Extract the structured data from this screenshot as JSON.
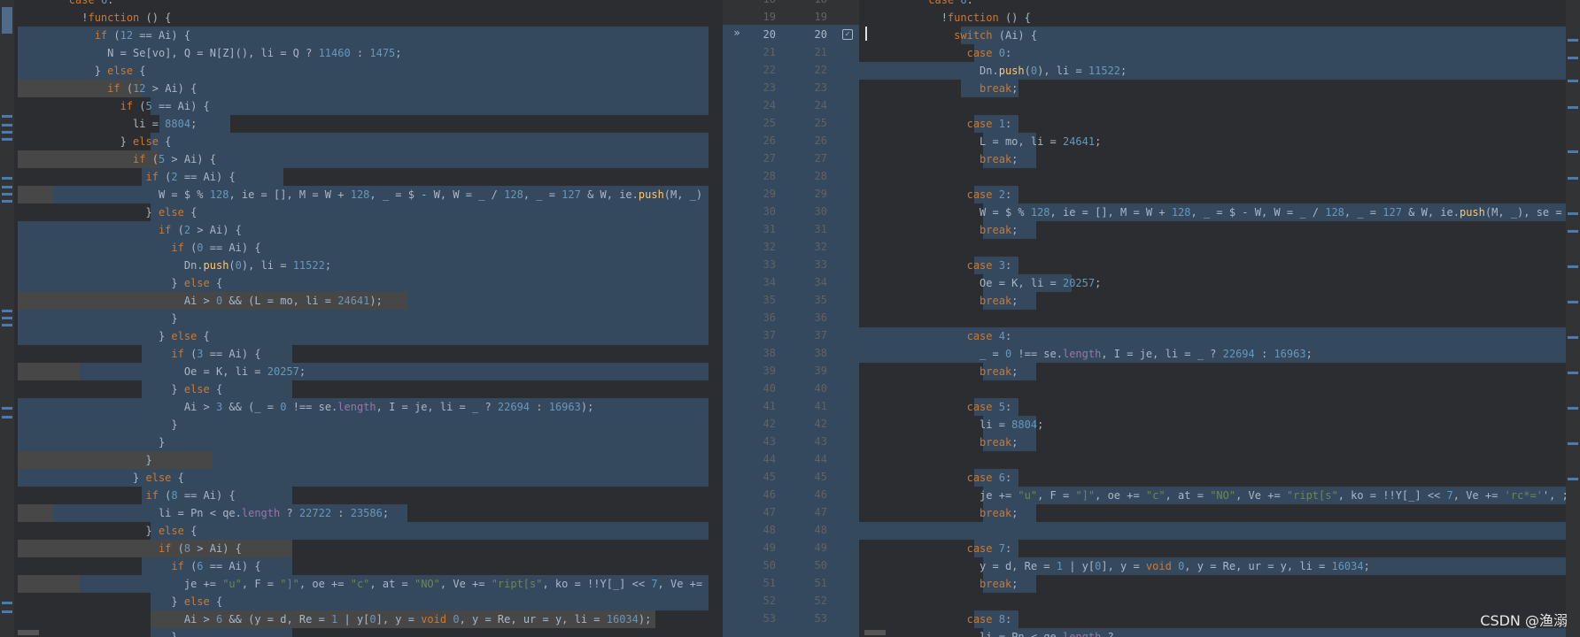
{
  "left_lines": [
    {
      "t": "        case 6:"
    },
    {
      "t": "          !function () {"
    },
    {
      "t": "            if (12 == Ai) {"
    },
    {
      "t": "              N = Se[vo], Q = N[Z](), li = Q ? 11460 : 1475;"
    },
    {
      "t": "            } else {"
    },
    {
      "t": "              if (12 > Ai) {"
    },
    {
      "t": "                if (5 == Ai) {"
    },
    {
      "t": "                  li = 8804;"
    },
    {
      "t": "                } else {"
    },
    {
      "t": "                  if (5 > Ai) {"
    },
    {
      "t": "                    if (2 == Ai) {"
    },
    {
      "t": "                      W = $ % 128, ie = [], M = W + 128, _ = $ - W, W = _ / 128, _ = 127 & W, ie.push(M, _)"
    },
    {
      "t": "                    } else {"
    },
    {
      "t": "                      if (2 > Ai) {"
    },
    {
      "t": "                        if (0 == Ai) {"
    },
    {
      "t": "                          Dn.push(0), li = 11522;"
    },
    {
      "t": "                        } else {"
    },
    {
      "t": "                          Ai > 0 && (L = mo, li = 24641);"
    },
    {
      "t": "                        }"
    },
    {
      "t": "                      } else {"
    },
    {
      "t": "                        if (3 == Ai) {"
    },
    {
      "t": "                          Oe = K, li = 20257;"
    },
    {
      "t": "                        } else {"
    },
    {
      "t": "                          Ai > 3 && (_ = 0 !== se.length, I = je, li = _ ? 22694 : 16963);"
    },
    {
      "t": "                        }"
    },
    {
      "t": "                      }"
    },
    {
      "t": "                    }"
    },
    {
      "t": "                  } else {"
    },
    {
      "t": "                    if (8 == Ai) {"
    },
    {
      "t": "                      li = Pn < qe.length ? 22722 : 23586;"
    },
    {
      "t": "                    } else {"
    },
    {
      "t": "                      if (8 > Ai) {"
    },
    {
      "t": "                        if (6 == Ai) {"
    },
    {
      "t": "                          je += \"u\", F = \"]\", oe += \"c\", at = \"NO\", Ve += \"ript[s\", ko = !!Y[_] << 7, Ve +="
    },
    {
      "t": "                        } else {"
    },
    {
      "t": "                          Ai > 6 && (y = d, Re = 1 | y[0], y = void 0, y = Re, ur = y, li = 16034);"
    },
    {
      "t": "                        }"
    }
  ],
  "gutter_left_numbers": [
    "18",
    "19",
    "20",
    "21",
    "22",
    "23",
    "24",
    "25",
    "26",
    "27",
    "28",
    "29",
    "30",
    "31",
    "32",
    "33",
    "34",
    "35",
    "36",
    "37",
    "38",
    "39",
    "40",
    "41",
    "42",
    "43",
    "44",
    "45",
    "46",
    "47",
    "48",
    "49",
    "50",
    "51",
    "52",
    "53"
  ],
  "gutter_right_numbers": [
    "18",
    "19",
    "20",
    "21",
    "22",
    "23",
    "24",
    "25",
    "26",
    "27",
    "28",
    "29",
    "30",
    "31",
    "32",
    "33",
    "34",
    "35",
    "36",
    "37",
    "38",
    "39",
    "40",
    "41",
    "42",
    "43",
    "44",
    "45",
    "46",
    "47",
    "48",
    "49",
    "50",
    "51",
    "52",
    "53"
  ],
  "right_lines": [
    {
      "t": "          case 6:"
    },
    {
      "t": "            !function () {"
    },
    {
      "t": "              switch (Ai) {"
    },
    {
      "t": "                case 0:"
    },
    {
      "t": "                  Dn.push(0), li = 11522;"
    },
    {
      "t": "                  break;"
    },
    {
      "t": ""
    },
    {
      "t": "                case 1:"
    },
    {
      "t": "                  L = mo, li = 24641;"
    },
    {
      "t": "                  break;"
    },
    {
      "t": ""
    },
    {
      "t": "                case 2:"
    },
    {
      "t": "                  W = $ % 128, ie = [], M = W + 128, _ = $ - W, W = _ / 128, _ = 127 & W, ie.push(M, _), se ="
    },
    {
      "t": "                  break;"
    },
    {
      "t": ""
    },
    {
      "t": "                case 3:"
    },
    {
      "t": "                  Oe = K, li = 20257;"
    },
    {
      "t": "                  break;"
    },
    {
      "t": ""
    },
    {
      "t": "                case 4:"
    },
    {
      "t": "                  _ = 0 !== se.length, I = je, li = _ ? 22694 : 16963;"
    },
    {
      "t": "                  break;"
    },
    {
      "t": ""
    },
    {
      "t": "                case 5:"
    },
    {
      "t": "                  li = 8804;"
    },
    {
      "t": "                  break;"
    },
    {
      "t": ""
    },
    {
      "t": "                case 6:"
    },
    {
      "t": "                  je += \"u\", F = \"]\", oe += \"c\", at = \"NO\", Ve += \"ript[s\", ko = !!Y[_] << 7, Ve += 'rc*='', ;"
    },
    {
      "t": "                  break;"
    },
    {
      "t": ""
    },
    {
      "t": "                case 7:"
    },
    {
      "t": "                  y = d, Re = 1 | y[0], y = void 0, y = Re, ur = y, li = 16034;"
    },
    {
      "t": "                  break;"
    },
    {
      "t": ""
    },
    {
      "t": "                case 8:"
    },
    {
      "t": "                  li = Pn < qe.length ? ..."
    }
  ],
  "gutter": {
    "active_line": "20",
    "accept_icon": "»",
    "checkbox_mark": "✓"
  },
  "watermark": "CSDN @渔溺",
  "colors": {
    "background": "#2b2d30",
    "diff_blue": "#34495e",
    "diff_grey": "#474747",
    "keyword": "#cc7832",
    "number": "#6897bb",
    "string": "#6a8759",
    "text": "#a9b7c6"
  }
}
